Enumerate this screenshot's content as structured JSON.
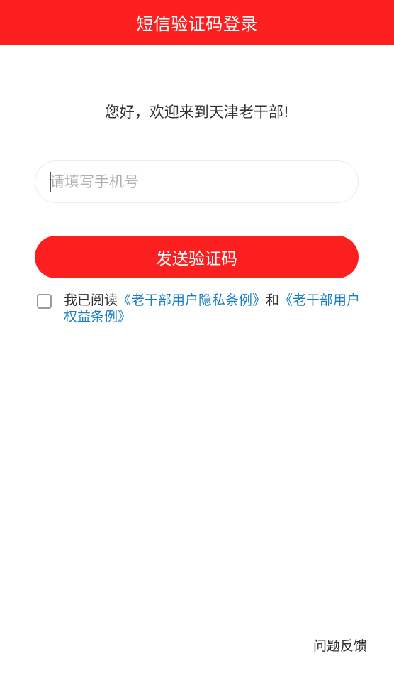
{
  "header": {
    "title": "短信验证码登录"
  },
  "welcome": "您好，欢迎来到天津老干部!",
  "phone_input": {
    "placeholder": "请填写手机号",
    "value": ""
  },
  "send_button": {
    "label": "发送验证码"
  },
  "agreement": {
    "checked": false,
    "prefix": "我已阅读",
    "link1": "《老干部用户隐私条例》",
    "conjunction": "和",
    "link2": "《老干部用户权益条例》"
  },
  "feedback": {
    "label": "问题反馈"
  },
  "colors": {
    "brand_red": "#fc1f20",
    "link_blue": "#1a7fc1"
  }
}
